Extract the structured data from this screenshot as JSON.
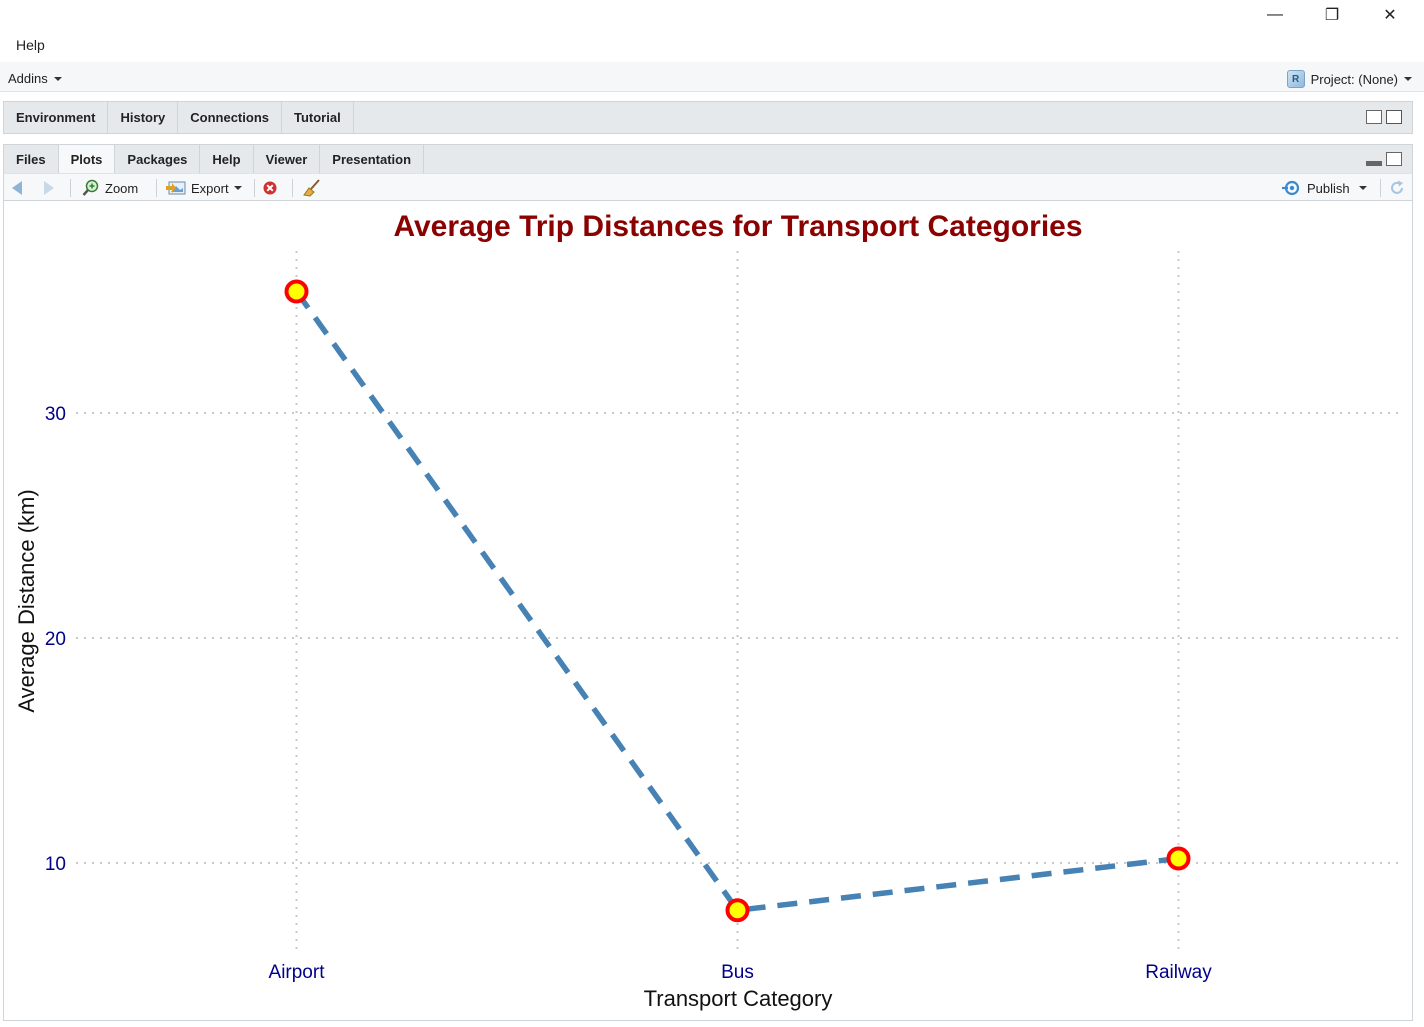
{
  "window": {
    "minimize_glyph": "—",
    "restore_glyph": "❐",
    "close_glyph": "✕"
  },
  "menu": {
    "help": "Help"
  },
  "addins": {
    "label": "Addins",
    "project_label": "Project: (None)",
    "project_icon_letter": "R"
  },
  "top_pane": {
    "tabs": [
      "Environment",
      "History",
      "Connections",
      "Tutorial"
    ]
  },
  "bottom_pane": {
    "tabs": [
      "Files",
      "Plots",
      "Packages",
      "Help",
      "Viewer",
      "Presentation"
    ],
    "active_tab": "Plots",
    "toolbar": {
      "zoom": "Zoom",
      "export": "Export",
      "publish": "Publish"
    }
  },
  "chart_data": {
    "type": "line",
    "title": "Average Trip Distances for Transport Categories",
    "xlabel": "Transport Category",
    "ylabel": "Average Distance (km)",
    "categories": [
      "Airport",
      "Bus",
      "Railway"
    ],
    "values": [
      35.4,
      7.9,
      10.2
    ],
    "yticks": [
      10,
      20,
      30
    ],
    "ylim": [
      6.0,
      37.2
    ],
    "grid": true,
    "colors": {
      "title": "#8b0000",
      "line": "#4682b4",
      "point_fill": "#ffff00",
      "point_stroke": "#ff0000",
      "tick_labels": "#00008b",
      "grid": "#c8c8c8"
    }
  }
}
